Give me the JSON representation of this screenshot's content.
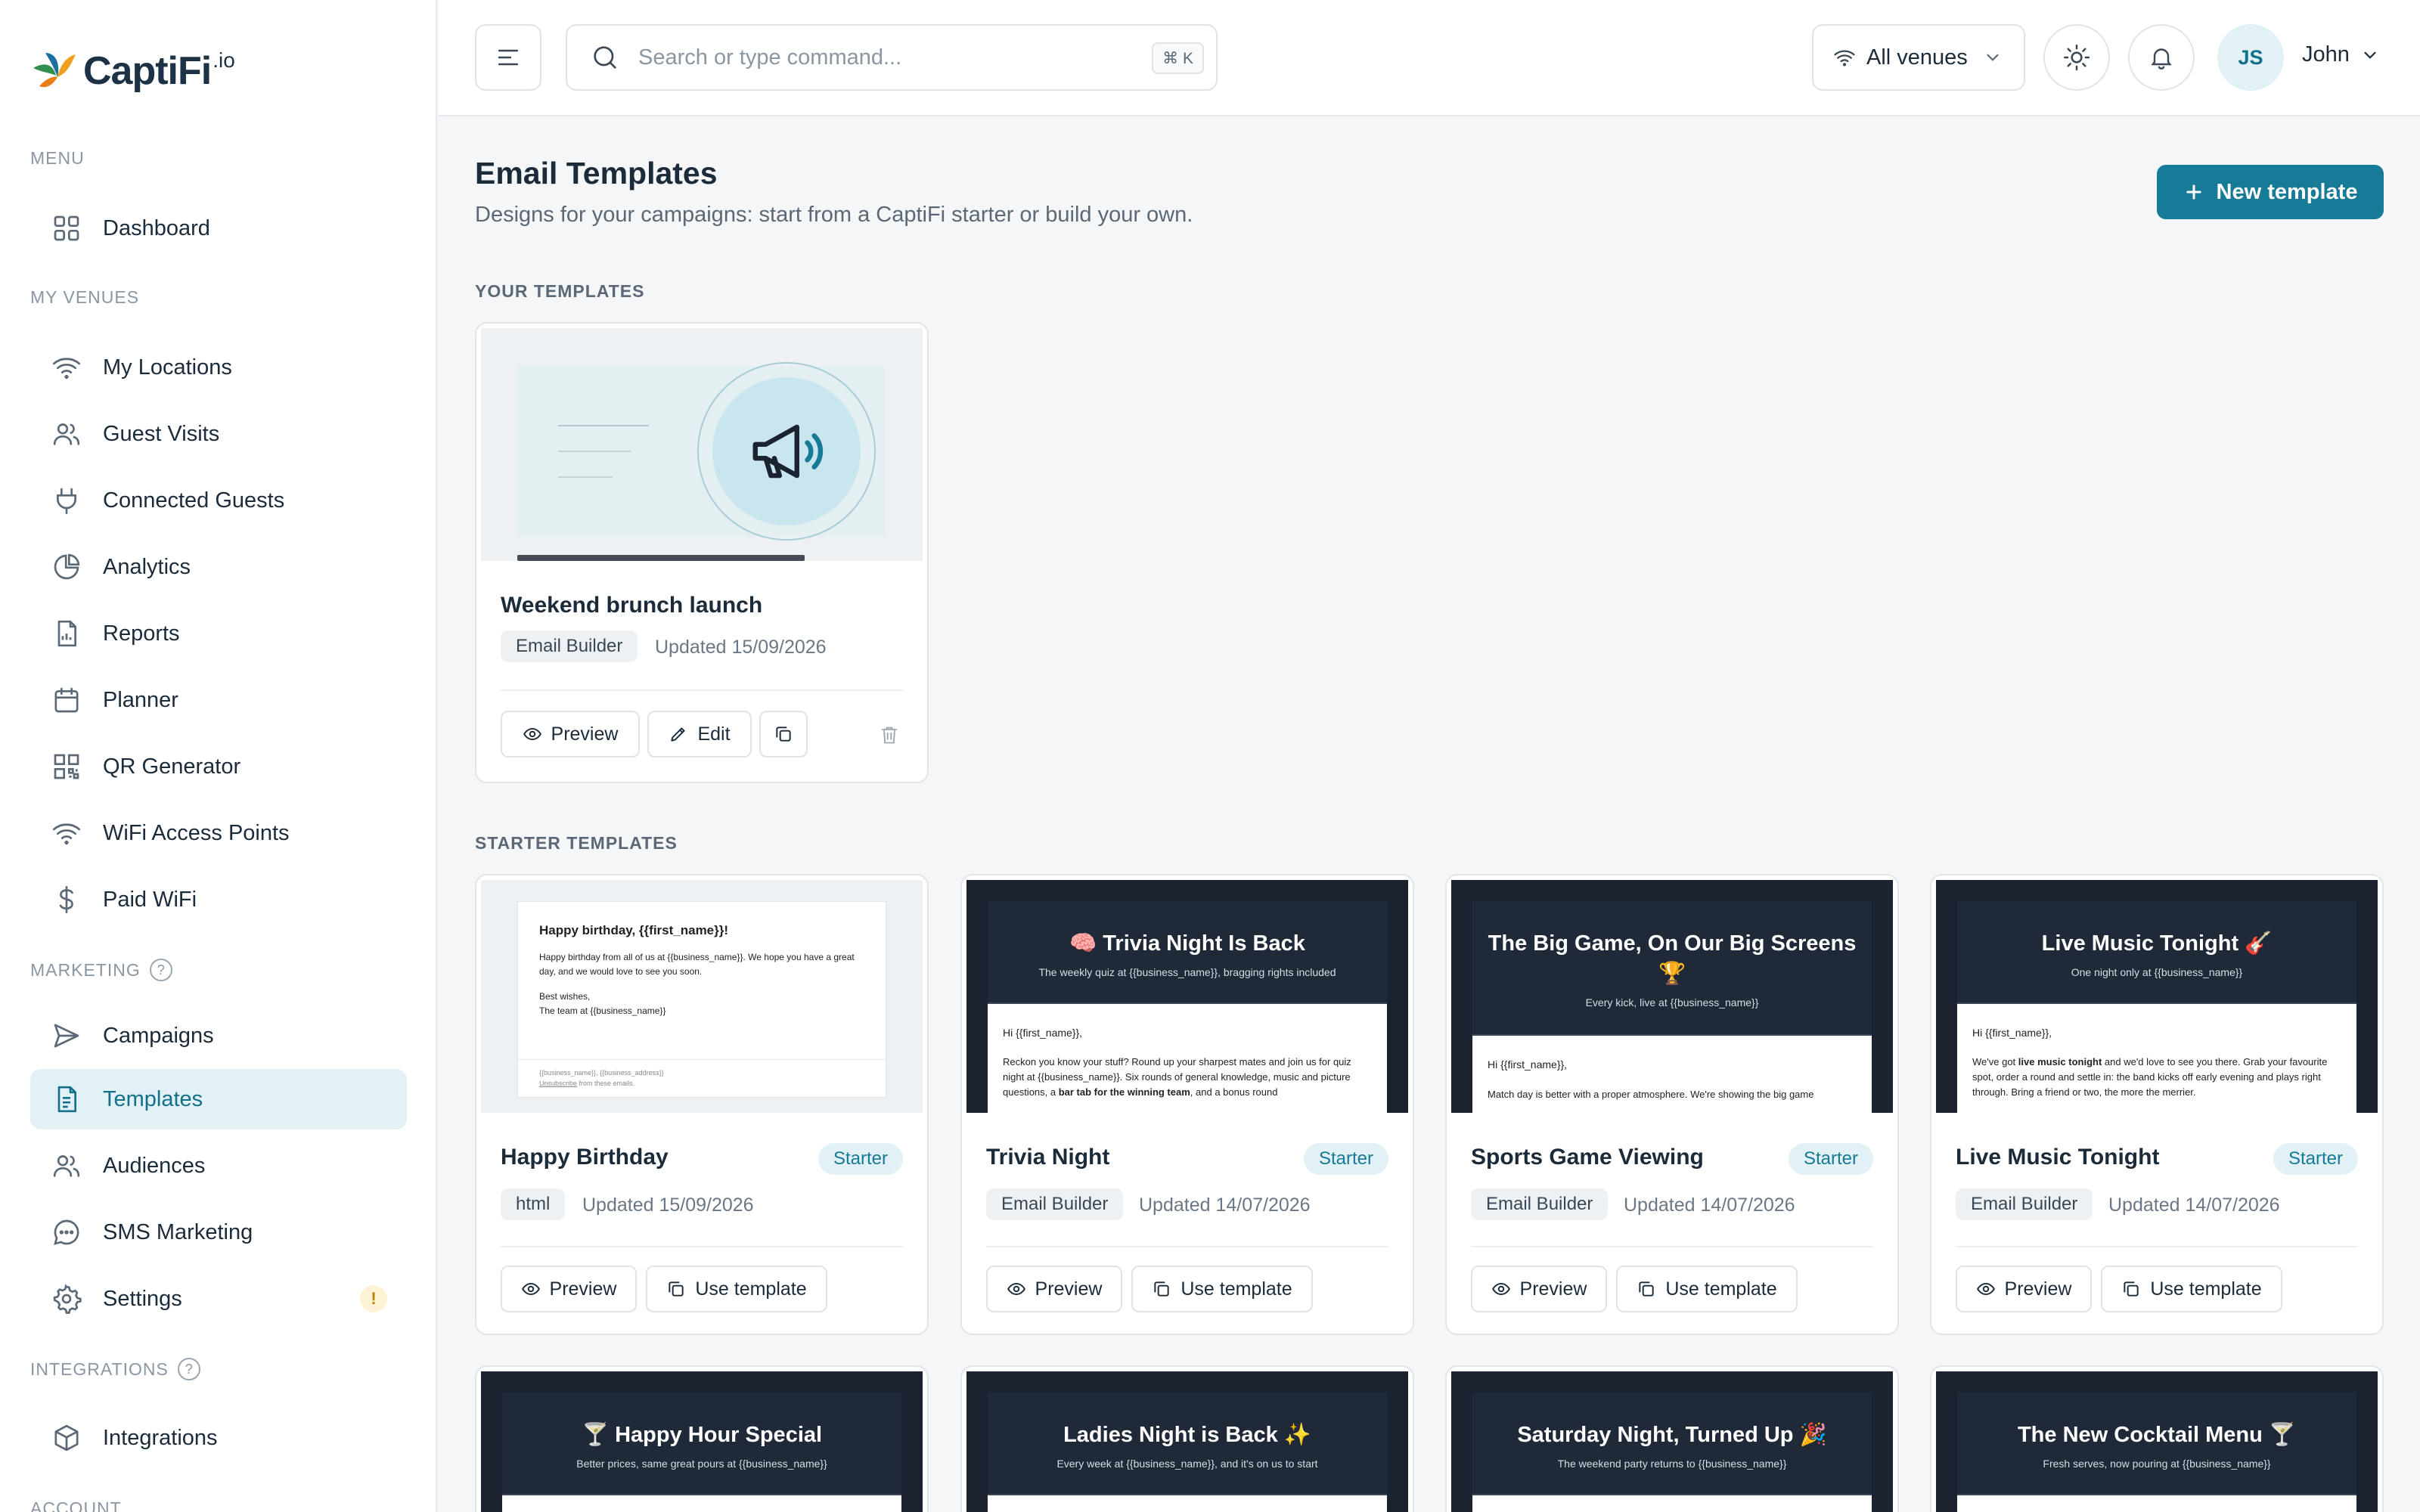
{
  "brand": {
    "name": "CaptiFi",
    "suffix": ".io"
  },
  "sidebar": {
    "menu_label": "MENU",
    "dashboard": "Dashboard",
    "venues_label": "MY VENUES",
    "venues": [
      "My Locations",
      "Guest Visits",
      "Connected Guests",
      "Analytics",
      "Reports",
      "Planner",
      "QR Generator",
      "WiFi Access Points",
      "Paid WiFi"
    ],
    "marketing_label": "MARKETING",
    "marketing": [
      "Campaigns",
      "Templates",
      "Audiences",
      "SMS Marketing",
      "Settings"
    ],
    "settings_alert": "!",
    "integrations_label": "INTEGRATIONS",
    "integrations": [
      "Integrations"
    ],
    "account_label": "ACCOUNT",
    "help_mark": "?"
  },
  "topbar": {
    "search_placeholder": "Search or type command...",
    "search_shortcut": "⌘ K",
    "venue_selector": "All venues",
    "user_initials": "JS",
    "user_name": "John"
  },
  "page": {
    "title": "Email Templates",
    "subtitle": "Designs for your campaigns: start from a CaptiFi starter or build your own.",
    "new_button": "New template"
  },
  "your_templates": {
    "heading": "YOUR TEMPLATES",
    "items": [
      {
        "name": "Weekend brunch launch",
        "type": "Email Builder",
        "updated": "Updated 15/09/2026",
        "preview": "Preview",
        "edit": "Edit"
      }
    ]
  },
  "starter_templates": {
    "heading": "STARTER TEMPLATES",
    "badge": "Starter",
    "preview_label": "Preview",
    "use_label": "Use template",
    "items": [
      {
        "name": "Happy Birthday",
        "type": "html",
        "updated": "Updated 15/09/2026"
      },
      {
        "name": "Trivia Night",
        "type": "Email Builder",
        "updated": "Updated 14/07/2026"
      },
      {
        "name": "Sports Game Viewing",
        "type": "Email Builder",
        "updated": "Updated 14/07/2026"
      },
      {
        "name": "Live Music Tonight",
        "type": "Email Builder",
        "updated": "Updated 14/07/2026"
      }
    ]
  },
  "thumbs": {
    "birthday": {
      "title": "Happy birthday, {{first_name}}!",
      "body": "Happy birthday from all of us at {{business_name}}. We hope you have a great day, and we would love to see you soon.",
      "sign1": "Best wishes,",
      "sign2": "The team at {{business_name}}",
      "footer": "{{business_name}}, {{business_address}}",
      "unsub": "Unsubscribe",
      "unsub_rest": " from these emails."
    },
    "trivia": {
      "heading": "🧠 Trivia Night Is Back",
      "tagline": "The weekly quiz at {{business_name}}, bragging rights included",
      "greeting": "Hi {{first_name}},",
      "body1": "Reckon you know your stuff? Round up your sharpest mates and join us for quiz night at {{business_name}}. Six rounds of general knowledge, music and picture questions, a ",
      "bold": "bar tab for the winning team",
      "body2": ", and a bonus round"
    },
    "sports": {
      "heading": "The Big Game, On Our Big Screens 🏆",
      "tagline": "Every kick, live at {{business_name}}",
      "greeting": "Hi {{first_name}},",
      "body": "Match day is better with a proper atmosphere. We're showing the big game"
    },
    "music": {
      "heading": "Live Music Tonight 🎸",
      "tagline": "One night only at {{business_name}}",
      "greeting": "Hi {{first_name}},",
      "body1": "We've got ",
      "bold": "live music tonight",
      "body2": " and we'd love to see you there. Grab your favourite spot, order a round and settle in: the band kicks off early evening and plays right through. Bring a friend or two, the more the merrier."
    },
    "row2": [
      {
        "heading": "🍸 Happy Hour Special",
        "tagline": "Better prices, same great pours at {{business_name}}"
      },
      {
        "heading": "Ladies Night is Back ✨",
        "tagline": "Every week at {{business_name}}, and it's on us to start"
      },
      {
        "heading": "Saturday Night, Turned Up 🎉",
        "tagline": "The weekend party returns to {{business_name}}"
      },
      {
        "heading": "The New Cocktail Menu 🍸",
        "tagline": "Fresh serves, now pouring at {{business_name}}"
      }
    ]
  },
  "colors": {
    "accent": "#177a96",
    "accent_bg": "#e2f1f5",
    "sidebar_active_text": "#13708a",
    "dark_email": "#1f2937"
  }
}
